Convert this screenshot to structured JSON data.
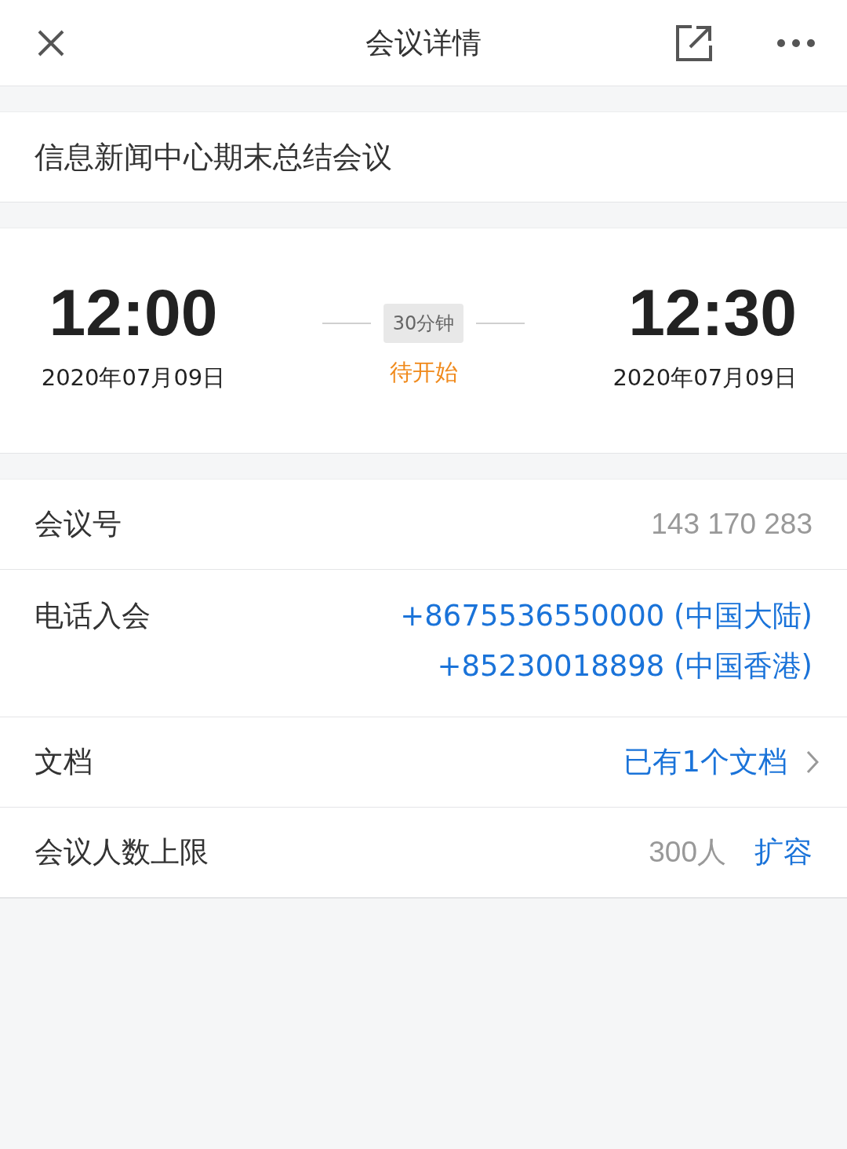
{
  "header": {
    "title": "会议详情"
  },
  "meeting": {
    "subject": "信息新闻中心期末总结会议"
  },
  "time": {
    "start": "12:00",
    "start_date": "2020年07月09日",
    "duration": "30分钟",
    "status": "待开始",
    "end": "12:30",
    "end_date": "2020年07月09日"
  },
  "details": [
    {
      "kind": "value",
      "label": "会议号",
      "values": [
        "143 170 283"
      ]
    },
    {
      "kind": "links",
      "label": "电话入会",
      "values": [
        "+8675536550000 (中国大陆)",
        "+85230018898 (中国香港)"
      ]
    },
    {
      "kind": "nav",
      "label": "文档",
      "values": [
        "已有1个文档"
      ]
    },
    {
      "kind": "action",
      "label": "会议人数上限",
      "values": [
        "300人"
      ],
      "action": "扩容"
    }
  ]
}
